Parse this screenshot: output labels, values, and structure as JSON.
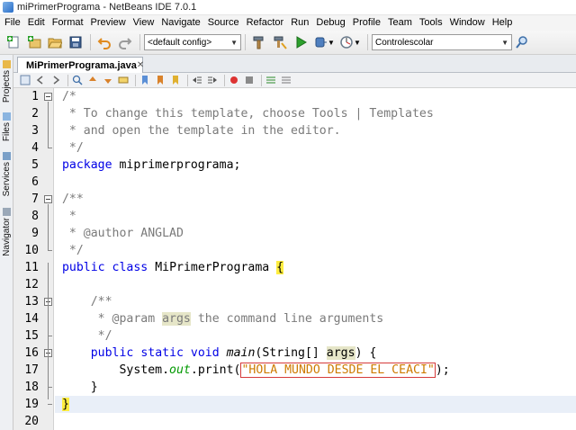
{
  "window": {
    "title": "miPrimerPrograma - NetBeans IDE 7.0.1"
  },
  "menu": [
    "File",
    "Edit",
    "Format",
    "Preview",
    "View",
    "Navigate",
    "Source",
    "Refactor",
    "Run",
    "Debug",
    "Profile",
    "Team",
    "Tools",
    "Window",
    "Help"
  ],
  "toolbar": {
    "config_combo": "<default config>",
    "project_combo": "Controlescolar"
  },
  "side_tabs": [
    "Projects",
    "Files",
    "Services",
    "Navigator"
  ],
  "editor_tab": {
    "label": "MiPrimerPrograma.java"
  },
  "gutter": {
    "line_numbers": [
      "1",
      "2",
      "3",
      "4",
      "5",
      "6",
      "7",
      "8",
      "9",
      "10",
      "11",
      "12",
      "13",
      "14",
      "15",
      "16",
      "17",
      "18",
      "19",
      "20"
    ]
  },
  "code_lines": [
    [
      {
        "t": "/*",
        "c": "comment"
      }
    ],
    [
      {
        "t": " * To change this template, choose Tools | Templates",
        "c": "comment"
      }
    ],
    [
      {
        "t": " * and open the template in the editor.",
        "c": "comment"
      }
    ],
    [
      {
        "t": " */",
        "c": "comment"
      }
    ],
    [
      {
        "t": "package",
        "c": "kw"
      },
      {
        "t": " miprimerprograma;",
        "c": "plain"
      }
    ],
    [],
    [
      {
        "t": "/**",
        "c": "comment"
      }
    ],
    [
      {
        "t": " *",
        "c": "comment"
      }
    ],
    [
      {
        "t": " * @author ANGLAD",
        "c": "comment"
      }
    ],
    [
      {
        "t": " */",
        "c": "comment"
      }
    ],
    [
      {
        "t": "public",
        "c": "kw"
      },
      {
        "t": " ",
        "c": "plain"
      },
      {
        "t": "class",
        "c": "kw"
      },
      {
        "t": " MiPrimerPrograma ",
        "c": "plain"
      },
      {
        "t": "{",
        "c": "brace"
      }
    ],
    [],
    [
      {
        "t": "    /**",
        "c": "comment"
      }
    ],
    [
      {
        "t": "     * @param ",
        "c": "comment"
      },
      {
        "t": "args",
        "c": "comment hl"
      },
      {
        "t": " the command line arguments",
        "c": "comment"
      }
    ],
    [
      {
        "t": "     */",
        "c": "comment"
      }
    ],
    [
      {
        "t": "    ",
        "c": "plain"
      },
      {
        "t": "public",
        "c": "kw"
      },
      {
        "t": " ",
        "c": "plain"
      },
      {
        "t": "static",
        "c": "kw"
      },
      {
        "t": " ",
        "c": "plain"
      },
      {
        "t": "void",
        "c": "kw"
      },
      {
        "t": " ",
        "c": "plain"
      },
      {
        "t": "main",
        "c": "fn"
      },
      {
        "t": "(String[] ",
        "c": "plain"
      },
      {
        "t": "args",
        "c": "hl"
      },
      {
        "t": ") {",
        "c": "plain"
      }
    ],
    [
      {
        "t": "        System.",
        "c": "plain"
      },
      {
        "t": "out",
        "c": "field"
      },
      {
        "t": ".print(",
        "c": "plain"
      },
      {
        "t": "\"HOLA MUNDO DESDE EL CEACI\"",
        "c": "str"
      },
      {
        "t": ");",
        "c": "plain"
      }
    ],
    [
      {
        "t": "    }",
        "c": "plain"
      }
    ],
    [
      {
        "t": "}",
        "c": "brace"
      }
    ],
    []
  ],
  "current_line": 19,
  "colors": {
    "keyword": "#0000e6",
    "comment": "#7a7a7a",
    "string": "#ce7b00",
    "field": "#009900",
    "brace_match": "#ffee40",
    "occurrence": "#e6e6c8"
  }
}
